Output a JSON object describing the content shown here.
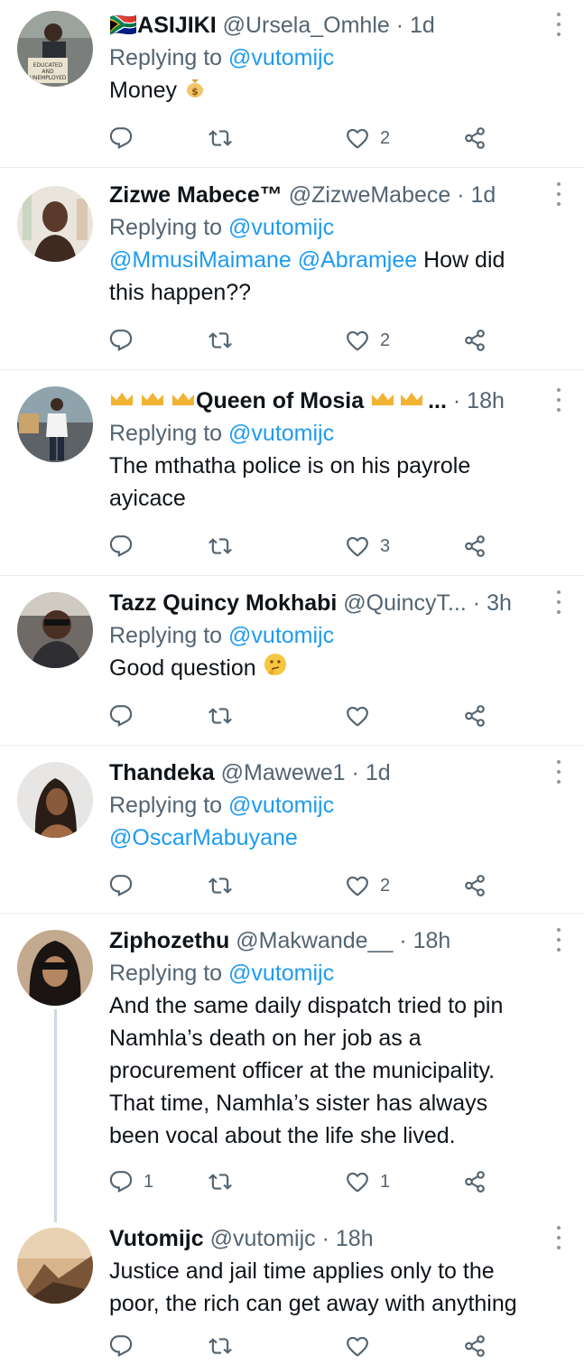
{
  "tweets": [
    {
      "flag": "🇿🇦",
      "name": "ASIJIKI",
      "handle": "@Ursela_Omhle",
      "time": "1d",
      "replying_prefix": "Replying to",
      "replying_to": "@vutomijc",
      "text_lines": [
        "Money"
      ],
      "text_emoji": "money-bag-emoji",
      "replies": "",
      "retweets": "",
      "likes": "2"
    },
    {
      "name": "Zizwe Mabece™",
      "handle": "@ZizweMabece",
      "time": "1d",
      "replying_prefix": "Replying to",
      "replying_to": "@vutomijc",
      "mentions": "@MmusiMaimane @Abramjee",
      "text_after_mentions": " How did",
      "text_lines": [
        "this happen??"
      ],
      "replies": "",
      "retweets": "",
      "likes": "2"
    },
    {
      "name_prefix_emoji": "crown-emoji",
      "name": "Queen of Mosia",
      "name_suffix": "...",
      "time": "18h",
      "replying_prefix": "Replying to",
      "replying_to": "@vutomijc",
      "text_lines": [
        "The mthatha police is on his payrole",
        "ayicace"
      ],
      "replies": "",
      "retweets": "",
      "likes": "3"
    },
    {
      "name": "Tazz Quincy Mokhabi",
      "handle": "@QuincyT...",
      "time": "3h",
      "replying_prefix": "Replying to",
      "replying_to": "@vutomijc",
      "text_lines": [
        "Good question"
      ],
      "text_emoji": "thinking-face-emoji",
      "replies": "",
      "retweets": "",
      "likes": ""
    },
    {
      "name": "Thandeka",
      "handle": "@Mawewe1",
      "time": "1d",
      "replying_prefix": "Replying to",
      "replying_to": "@vutomijc",
      "mentions": "@OscarMabuyane",
      "replies": "",
      "retweets": "",
      "likes": "2"
    },
    {
      "name": "Ziphozethu",
      "handle": "@Makwande__",
      "time": "18h",
      "replying_prefix": "Replying to",
      "replying_to": "@vutomijc",
      "text_lines": [
        "And the same daily dispatch tried to pin",
        "Namhla’s death on her job as a",
        "procurement officer at the municipality.",
        "That time, Namhla’s sister has always",
        "been vocal about the life she lived."
      ],
      "replies": "1",
      "retweets": "",
      "likes": "1"
    },
    {
      "name": "Vutomijc",
      "handle": "@vutomijc",
      "time": "18h",
      "text_lines": [
        "Justice and jail time applies only to the",
        "poor, the rich can get away with anything"
      ],
      "replies": "",
      "retweets": "",
      "likes": ""
    }
  ],
  "separator": "·",
  "colors": {
    "link": "#1d9bf0",
    "muted": "#536471",
    "text": "#0f1419",
    "divider": "#e6ecf0"
  }
}
